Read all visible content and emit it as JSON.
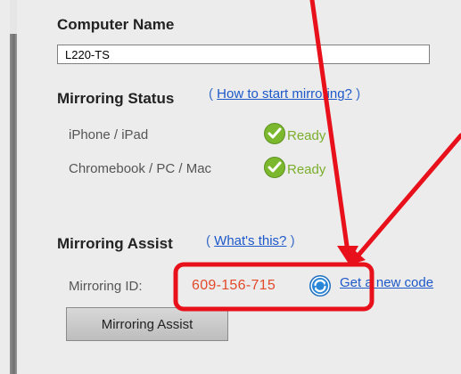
{
  "computer_name": {
    "heading": "Computer Name",
    "value": "L220-TS"
  },
  "mirroring_status": {
    "heading": "Mirroring Status",
    "paren_open": "(",
    "link": "How to start mirroring?",
    "paren_close": ")",
    "rows": [
      {
        "label": "iPhone / iPad",
        "status": "Ready"
      },
      {
        "label": "Chromebook / PC / Mac",
        "status": "Ready"
      }
    ]
  },
  "mirroring_assist": {
    "heading": "Mirroring Assist",
    "paren_open": "(",
    "link": "What's this?",
    "paren_close": ")",
    "id_label": "Mirroring ID:",
    "id_value": "609-156-715",
    "new_code_link": "Get a new code",
    "button_label": "Mirroring Assist"
  },
  "icons": [
    "check-icon",
    "refresh-icon"
  ],
  "colors": {
    "annotation": "#e8101a",
    "link": "#1c58c9",
    "ready": "#7aae2b",
    "mirroring_id": "#e24a2a"
  }
}
